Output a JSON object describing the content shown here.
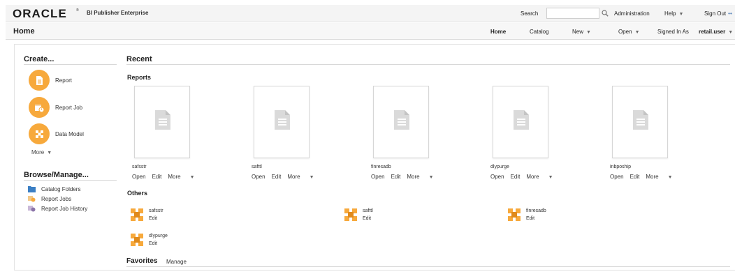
{
  "header": {
    "logo": "ORACLE",
    "logo_mark": "®",
    "product": "BI Publisher Enterprise",
    "search_label": "Search",
    "search_value": "",
    "administration": "Administration",
    "help": "Help",
    "sign_out": "Sign Out"
  },
  "nav": {
    "page_title": "Home",
    "home": "Home",
    "catalog": "Catalog",
    "new": "New",
    "open": "Open",
    "signed_in_as": "Signed In As",
    "user": "retail.user"
  },
  "create": {
    "heading": "Create...",
    "items": [
      "Report",
      "Report Job",
      "Data Model"
    ],
    "more": "More"
  },
  "browse": {
    "heading": "Browse/Manage...",
    "items": [
      "Catalog Folders",
      "Report Jobs",
      "Report Job History"
    ]
  },
  "recent": {
    "heading": "Recent",
    "reports_heading": "Reports",
    "reports": [
      {
        "name": "safsstr",
        "open": "Open",
        "edit": "Edit",
        "more": "More"
      },
      {
        "name": "safttl",
        "open": "Open",
        "edit": "Edit",
        "more": "More"
      },
      {
        "name": "finresadb",
        "open": "Open",
        "edit": "Edit",
        "more": "More"
      },
      {
        "name": "dlypurge",
        "open": "Open",
        "edit": "Edit",
        "more": "More"
      },
      {
        "name": "inbpoship",
        "open": "Open",
        "edit": "Edit",
        "more": "More"
      }
    ],
    "others_heading": "Others",
    "others": [
      {
        "name": "safsstr",
        "edit": "Edit"
      },
      {
        "name": "safttl",
        "edit": "Edit"
      },
      {
        "name": "finresadb",
        "edit": "Edit"
      },
      {
        "name": "dlypurge",
        "edit": "Edit"
      }
    ]
  },
  "favorites": {
    "heading": "Favorites",
    "manage": "Manage"
  },
  "colors": {
    "accent_orange": "#f7a93c",
    "folder_blue": "#3b7fc4",
    "link_blue": "#4a7bb5"
  },
  "icons": {
    "report": "report-icon",
    "report_job": "report-job-icon",
    "data_model": "data-model-icon",
    "folder": "folder-icon",
    "search": "search-icon"
  }
}
